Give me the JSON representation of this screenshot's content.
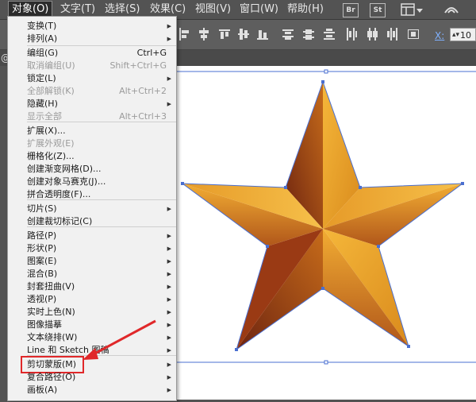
{
  "menubar": {
    "items": [
      {
        "label": "对象(O)",
        "active": true
      },
      {
        "label": "文字(T)"
      },
      {
        "label": "选择(S)"
      },
      {
        "label": "效果(C)"
      },
      {
        "label": "视图(V)"
      },
      {
        "label": "窗口(W)"
      },
      {
        "label": "帮助(H)"
      }
    ],
    "badges": [
      "Br",
      "St"
    ],
    "icons": [
      "layout-icon",
      "chevron-down-icon",
      "sync-icon"
    ]
  },
  "controlbar": {
    "x_label": "X:",
    "x_value": "10"
  },
  "doctab": {
    "prefix": "@"
  },
  "object_menu": {
    "items": [
      {
        "label": "变换(T)",
        "shortcut": "",
        "submenu": true,
        "disabled": false
      },
      {
        "label": "排列(A)",
        "shortcut": "",
        "submenu": true,
        "disabled": false
      },
      {
        "label": "编组(G)",
        "shortcut": "Ctrl+G",
        "submenu": false,
        "disabled": false
      },
      {
        "label": "取消编组(U)",
        "shortcut": "Shift+Ctrl+G",
        "submenu": false,
        "disabled": true
      },
      {
        "label": "锁定(L)",
        "shortcut": "",
        "submenu": true,
        "disabled": false
      },
      {
        "label": "全部解锁(K)",
        "shortcut": "Alt+Ctrl+2",
        "submenu": false,
        "disabled": true
      },
      {
        "label": "隐藏(H)",
        "shortcut": "",
        "submenu": true,
        "disabled": false
      },
      {
        "label": "显示全部",
        "shortcut": "Alt+Ctrl+3",
        "submenu": false,
        "disabled": true
      },
      {
        "label": "扩展(X)...",
        "shortcut": "",
        "submenu": false,
        "disabled": false
      },
      {
        "label": "扩展外观(E)",
        "shortcut": "",
        "submenu": false,
        "disabled": true
      },
      {
        "label": "栅格化(Z)...",
        "shortcut": "",
        "submenu": false,
        "disabled": false
      },
      {
        "label": "创建渐变网格(D)...",
        "shortcut": "",
        "submenu": false,
        "disabled": false
      },
      {
        "label": "创建对象马赛克(J)...",
        "shortcut": "",
        "submenu": false,
        "disabled": false
      },
      {
        "label": "拼合透明度(F)...",
        "shortcut": "",
        "submenu": false,
        "disabled": false
      },
      {
        "label": "切片(S)",
        "shortcut": "",
        "submenu": true,
        "disabled": false
      },
      {
        "label": "创建裁切标记(C)",
        "shortcut": "",
        "submenu": false,
        "disabled": false
      },
      {
        "label": "路径(P)",
        "shortcut": "",
        "submenu": true,
        "disabled": false
      },
      {
        "label": "形状(P)",
        "shortcut": "",
        "submenu": true,
        "disabled": false
      },
      {
        "label": "图案(E)",
        "shortcut": "",
        "submenu": true,
        "disabled": false
      },
      {
        "label": "混合(B)",
        "shortcut": "",
        "submenu": true,
        "disabled": false
      },
      {
        "label": "封套扭曲(V)",
        "shortcut": "",
        "submenu": true,
        "disabled": false
      },
      {
        "label": "透视(P)",
        "shortcut": "",
        "submenu": true,
        "disabled": false
      },
      {
        "label": "实时上色(N)",
        "shortcut": "",
        "submenu": true,
        "disabled": false
      },
      {
        "label": "图像描摹",
        "shortcut": "",
        "submenu": true,
        "disabled": false
      },
      {
        "label": "文本绕排(W)",
        "shortcut": "",
        "submenu": true,
        "disabled": false
      },
      {
        "label": "Line 和 Sketch 图稿",
        "shortcut": "",
        "submenu": true,
        "disabled": false
      },
      {
        "label": "剪切蒙版(M)",
        "shortcut": "",
        "submenu": true,
        "disabled": false,
        "highlighted": true
      },
      {
        "label": "复合路径(O)",
        "shortcut": "",
        "submenu": true,
        "disabled": false
      },
      {
        "label": "画板(A)",
        "shortcut": "",
        "submenu": true,
        "disabled": false
      }
    ]
  },
  "colors": {
    "highlight_box": "#e0282a",
    "arrow": "#e0282a",
    "star_light": "#f2b134",
    "star_dark": "#7a2a10"
  }
}
